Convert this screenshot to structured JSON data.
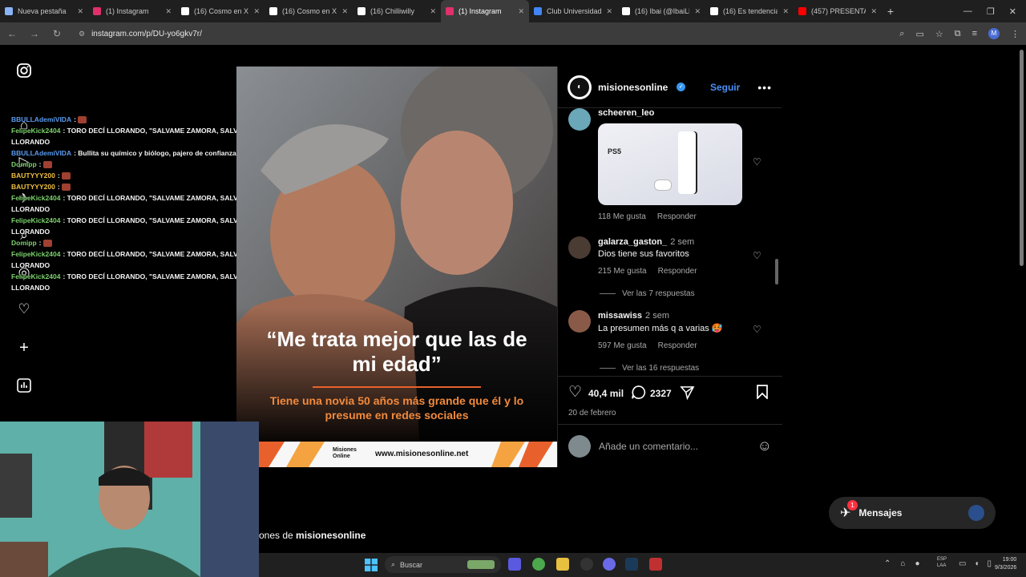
{
  "browser": {
    "tabs": [
      {
        "label": "Nueva pestaña",
        "color": "#8ab4f8",
        "active": false
      },
      {
        "label": "(1) Instagram",
        "color": "#e1306c",
        "active": false
      },
      {
        "label": "(16) Cosmo en X",
        "color": "#ffffff",
        "active": false
      },
      {
        "label": "(16) Cosmo en X",
        "color": "#ffffff",
        "active": false
      },
      {
        "label": "(16) Chilliwilly",
        "color": "#ffffff",
        "active": false
      },
      {
        "label": "(1) Instagram",
        "color": "#e1306c",
        "active": true
      },
      {
        "label": "Club Universidad",
        "color": "#4285f4",
        "active": false
      },
      {
        "label": "(16) Ibai (@IbaiLl",
        "color": "#ffffff",
        "active": false
      },
      {
        "label": "(16) Es tendencia",
        "color": "#ffffff",
        "active": false
      },
      {
        "label": "(457) PRESENTAC",
        "color": "#ff0000",
        "active": false
      }
    ],
    "url": "instagram.com/p/DU-yo6gkv7r/",
    "profile_initial": "M"
  },
  "chat": [
    {
      "user": "BBULLAdemiVIDA",
      "ucolor": "#5a9bf0",
      "text": "",
      "emote": true
    },
    {
      "user": "FelipeKick2404",
      "ucolor": "#7bd16b",
      "text": "TORO DECÍ LLORANDO, \"SALVAME ZAMORA, SALVAME\" LLORANDO",
      "emote": false
    },
    {
      "user": "BBULLAdemiVIDA",
      "ucolor": "#5a9bf0",
      "text": "Bullita su químico y biólogo, pajero de confianza",
      "emote": false
    },
    {
      "user": "Domipp",
      "ucolor": "#7bd16b",
      "text": "",
      "emote": true
    },
    {
      "user": "BAUTYYY200",
      "ucolor": "#f0c040",
      "text": "",
      "emote": true
    },
    {
      "user": "BAUTYYY200",
      "ucolor": "#f0c040",
      "text": "",
      "emote": true
    },
    {
      "user": "FelipeKick2404",
      "ucolor": "#7bd16b",
      "text": "TORO DECÍ LLORANDO, \"SALVAME ZAMORA, SALVAME\" LLORANDO",
      "emote": false
    },
    {
      "user": "FelipeKick2404",
      "ucolor": "#7bd16b",
      "text": "TORO DECÍ LLORANDO, \"SALVAME ZAMORA, SALVAME\" LLORANDO",
      "emote": false
    },
    {
      "user": "Domipp",
      "ucolor": "#7bd16b",
      "text": "",
      "emote": true
    },
    {
      "user": "FelipeKick2404",
      "ucolor": "#7bd16b",
      "text": "TORO DECÍ LLORANDO, \"SALVAME ZAMORA, SALVAME\" LLORANDO",
      "emote": false
    },
    {
      "user": "FelipeKick2404",
      "ucolor": "#7bd16b",
      "text": "TORO DECÍ LLORANDO, \"SALVAME ZAMORA, SALVAME\" LLORANDO",
      "emote": false
    }
  ],
  "post": {
    "quote": "“Me trata mejor que las de mi edad”",
    "subtitle": "Tiene una novia 50 años más grande que él y lo presume en redes sociales",
    "brand": "Misiones Online",
    "website": "www.misionesonline.net"
  },
  "panel": {
    "username": "misionesonline",
    "follow": "Seguir",
    "comments": [
      {
        "user": "scheeren_leo",
        "time": "",
        "text": "",
        "likes": "118 Me gusta",
        "reply": "Responder",
        "image_label": "PS5"
      },
      {
        "user": "galarza_gaston_",
        "time": "2 sem",
        "text": "Dios tiene sus favoritos",
        "likes": "215 Me gusta",
        "reply": "Responder",
        "view_replies": "Ver las 7 respuestas"
      },
      {
        "user": "missawiss",
        "time": "2 sem",
        "text": "La presumen más q a varias 🥵",
        "likes": "597 Me gusta",
        "reply": "Responder",
        "view_replies": "Ver las 16 respuestas"
      }
    ],
    "like_count": "40,4 mil",
    "comment_count": "2327",
    "date": "20 de febrero",
    "add_comment_placeholder": "Añade un comentario..."
  },
  "footer": {
    "more_from": "ones de misionesonline",
    "more_prefix": "ones de ",
    "more_user": "misionesonline"
  },
  "messages": {
    "label": "Mensajes",
    "badge": "1"
  },
  "taskbar": {
    "search": "Buscar",
    "lang": "ESP\nLAA",
    "time": "19:00",
    "date": "9/3/2026"
  }
}
